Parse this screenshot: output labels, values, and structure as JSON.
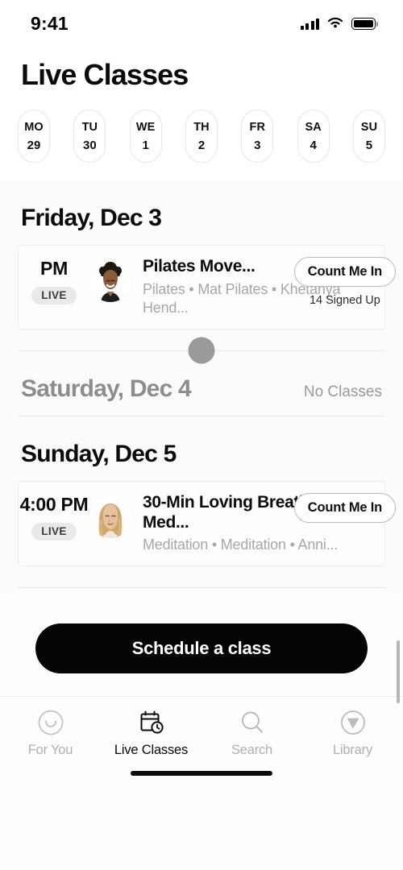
{
  "status_bar": {
    "time": "9:41",
    "icons": [
      "signal-bars",
      "wifi",
      "battery"
    ]
  },
  "header": {
    "title": "Live Classes",
    "date_strip": [
      {
        "dow": "MO",
        "num": "29"
      },
      {
        "dow": "TU",
        "num": "30"
      },
      {
        "dow": "WE",
        "num": "1"
      },
      {
        "dow": "TH",
        "num": "2"
      },
      {
        "dow": "FR",
        "num": "3"
      },
      {
        "dow": "SA",
        "num": "4"
      },
      {
        "dow": "SU",
        "num": "5"
      }
    ]
  },
  "days": [
    {
      "title": "Friday, Dec 3",
      "note": "",
      "classes": [
        {
          "time": "PM",
          "live_badge": "LIVE",
          "name": "Pilates Move...",
          "meta": "Pilates • Mat Pilates • Khetanya Hend...",
          "action_label": "Count Me In",
          "signed_up": "14 Signed Up",
          "instructor_avatar": "woman-curly-hair-portrait"
        }
      ]
    },
    {
      "title": "Saturday, Dec 4",
      "note": "No Classes",
      "classes": []
    },
    {
      "title": "Sunday, Dec 5",
      "note": "",
      "classes": [
        {
          "time": "4:00 PM",
          "live_badge": "LIVE",
          "name": "30-Min Loving Breath & Med...",
          "meta": "Meditation • Meditation • Anni...",
          "action_label": "Count Me In",
          "signed_up": "",
          "instructor_avatar": "woman-blonde-hair-portrait"
        }
      ]
    }
  ],
  "cta": {
    "label": "Schedule a class"
  },
  "tabbar": {
    "active": "Live Classes",
    "items": [
      {
        "label": "For You",
        "icon": "smiley-face-icon"
      },
      {
        "label": "Live Classes",
        "icon": "calendar-clock-icon"
      },
      {
        "label": "Search",
        "icon": "search-icon"
      },
      {
        "label": "Library",
        "icon": "circle-triangle-icon"
      }
    ]
  },
  "colors": {
    "accent": "#050505",
    "muted_text": "#a8a8a8",
    "badge_bg": "#e9e9e9",
    "card_border": "#ededed"
  }
}
